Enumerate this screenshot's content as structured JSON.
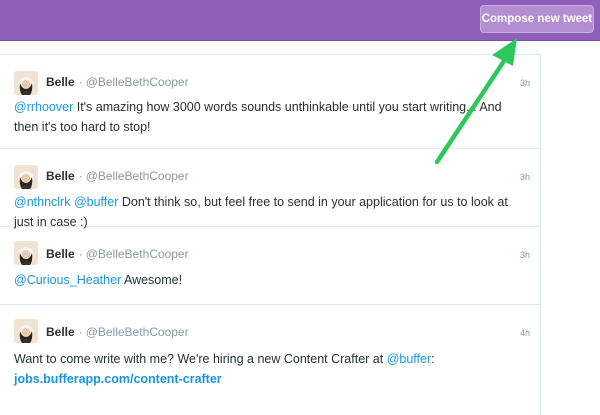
{
  "header": {
    "compose_label": "Compose new tweet"
  },
  "tweets": [
    {
      "name": "Belle",
      "handle": "@BelleBethCooper",
      "time": "3h",
      "mention": "@rrhoover",
      "text": " It's amazing how 3000 words sounds unthinkable until you start writing... And then it's too hard to stop!"
    },
    {
      "name": "Belle",
      "handle": "@BelleBethCooper",
      "time": "3h",
      "mention": "@nthnclrk",
      "mention2": "@buffer",
      "text": " Don't think so, but feel free to send in your application for us to look at just in case :)"
    },
    {
      "name": "Belle",
      "handle": "@BelleBethCooper",
      "time": "3h",
      "mention": "@Curious_Heather",
      "text": " Awesome!"
    },
    {
      "name": "Belle",
      "handle": "@BelleBethCooper",
      "time": "4h",
      "text": "Want to come write with me? We're hiring a new Content Crafter at ",
      "mention": "@buffer",
      "text_after": ":",
      "link": "jobs.bufferapp.com/content-crafter"
    }
  ],
  "colors": {
    "header_bg": "#8f5fba",
    "compose_bg": "#b38fd2",
    "mention": "#1b95e0",
    "arrow": "#2ec85a"
  },
  "icons": {
    "arrow": "annotation-arrow-icon",
    "avatar": "user-avatar"
  }
}
